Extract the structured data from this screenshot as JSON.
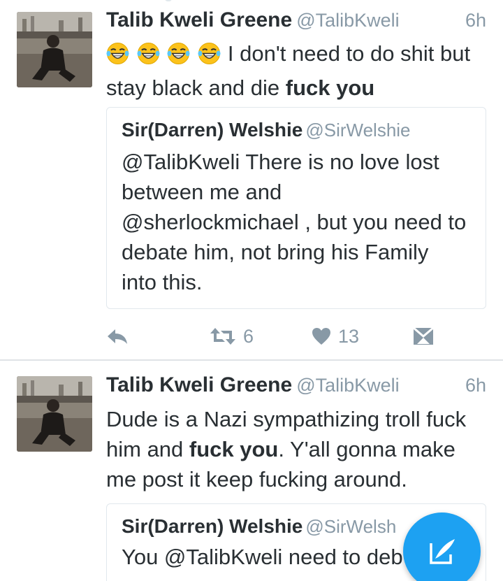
{
  "tweets": [
    {
      "author_name": "Talib Kweli Greene",
      "author_handle": "@TalibKweli",
      "time": "6h",
      "text_line1": "I don't need to do shit but",
      "text_line2_plain": "stay black and die ",
      "text_line2_bold": "fuck you",
      "quote": {
        "author_name": "Sir(Darren) Welshie",
        "author_handle": "@SirWelshie",
        "lines": [
          "@TalibKweli There is no love lost",
          "between me and",
          "@sherlockmichael , but you need to",
          "debate him, not bring his Family",
          "into this."
        ]
      },
      "retweet_count": "6",
      "like_count": "13"
    },
    {
      "author_name": "Talib Kweli Greene",
      "author_handle": "@TalibKweli",
      "time": "6h",
      "line1": "Dude is a Nazi sympathizing troll fuck",
      "line2_plain_a": "him and ",
      "line2_bold": "fuck you",
      "line2_plain_b": ". Y'all gonna make",
      "line3": "me post it keep fucking around.",
      "quote": {
        "author_name": "Sir(Darren) Welshie",
        "author_handle": "@SirWelsh",
        "line1": "You @TalibKweli need to deb"
      }
    }
  ],
  "icons": {
    "emoji": "face-with-tears-of-joy-icon",
    "reply": "reply-icon",
    "retweet": "retweet-icon",
    "like": "heart-icon",
    "dm": "direct-message-icon",
    "compose": "compose-tweet-icon"
  },
  "colors": {
    "accent": "#1da1f2",
    "text": "#292f33",
    "muted": "#8899a6"
  }
}
